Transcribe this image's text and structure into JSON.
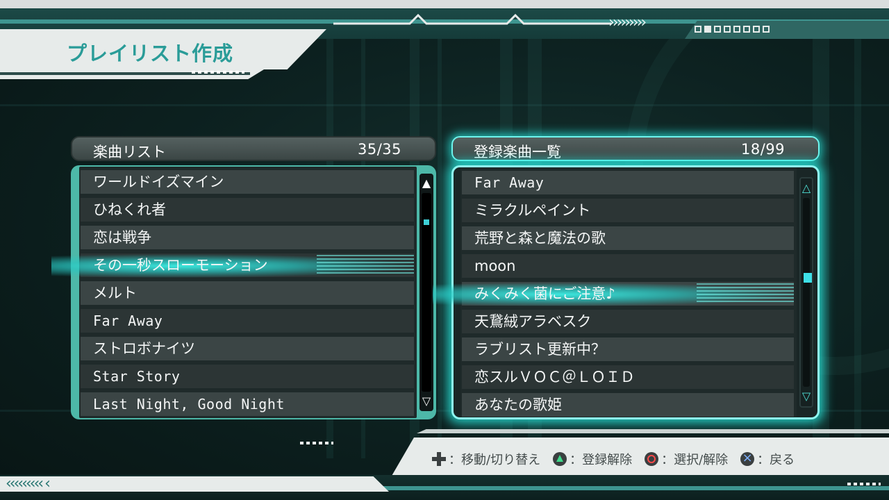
{
  "header": {
    "title": "プレイリスト作成"
  },
  "song_list": {
    "title": "楽曲リスト",
    "count": "35/35",
    "items": [
      "ワールドイズマイン",
      "ひねくれ者",
      "恋は戦争",
      "その一秒スローモーション",
      "メルト",
      "Far Away",
      "ストロボナイツ",
      "Star Story",
      "Last Night, Good Night"
    ],
    "selected_index": 3
  },
  "registered_list": {
    "title": "登録楽曲一覧",
    "count": "18/99",
    "items": [
      "Far Away",
      "ミラクルペイント",
      "荒野と森と魔法の歌",
      "moon",
      "みくみく菌にご注意♪",
      "天鵞絨アラベスク",
      "ラブリスト更新中？",
      "恋スルＶＯＣ＠ＬＯＩＤ",
      "あなたの歌姫"
    ],
    "selected_index": 4
  },
  "controls": {
    "move": "：移動/切り替え",
    "unregister": "：登録解除",
    "select": "：選択/解除",
    "back": "：戻る"
  },
  "icons": {
    "dpad": "dpad-icon",
    "triangle": "triangle-button-icon",
    "circle": "circle-button-icon",
    "cross": "cross-button-icon"
  },
  "colors": {
    "accent": "#2a9c98",
    "highlight": "#3ce8e0",
    "panel": "#3b4545"
  }
}
